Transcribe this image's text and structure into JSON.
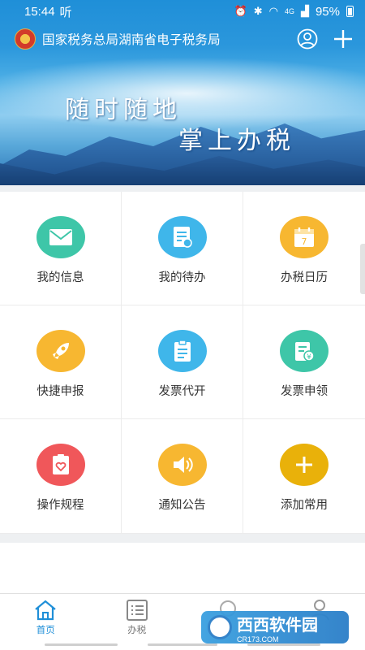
{
  "status": {
    "time": "15:44",
    "carrier": "听",
    "network": "4G",
    "battery": "95%"
  },
  "app": {
    "title": "国家税务总局湖南省电子税务局"
  },
  "banner": {
    "line1": "随时随地",
    "line2": "掌上办税"
  },
  "grid": [
    {
      "label": "我的信息",
      "icon": "envelope-icon",
      "color": "#3ec6a8"
    },
    {
      "label": "我的待办",
      "icon": "todo-document-icon",
      "color": "#3fb6ea"
    },
    {
      "label": "办税日历",
      "icon": "calendar-icon",
      "color": "#f7b731"
    },
    {
      "label": "快捷申报",
      "icon": "rocket-icon",
      "color": "#f7b731"
    },
    {
      "label": "发票代开",
      "icon": "clipboard-icon",
      "color": "#3fb6ea"
    },
    {
      "label": "发票申领",
      "icon": "invoice-yuan-icon",
      "color": "#3ec6a8"
    },
    {
      "label": "操作规程",
      "icon": "heart-document-icon",
      "color": "#f0575a"
    },
    {
      "label": "通知公告",
      "icon": "speaker-icon",
      "color": "#f7b731"
    },
    {
      "label": "添加常用",
      "icon": "plus-icon",
      "color": "#e9b10a"
    }
  ],
  "tabs": [
    {
      "label": "首页",
      "icon": "home-icon",
      "active": true
    },
    {
      "label": "办税",
      "icon": "list-icon",
      "active": false
    },
    {
      "label": "",
      "icon": "service-icon",
      "active": false
    },
    {
      "label": "",
      "icon": "person-icon",
      "active": false
    }
  ],
  "watermark": {
    "brand": "西西软件园",
    "site": "CR173.COM"
  },
  "colors": {
    "accent": "#1f8fd8"
  }
}
